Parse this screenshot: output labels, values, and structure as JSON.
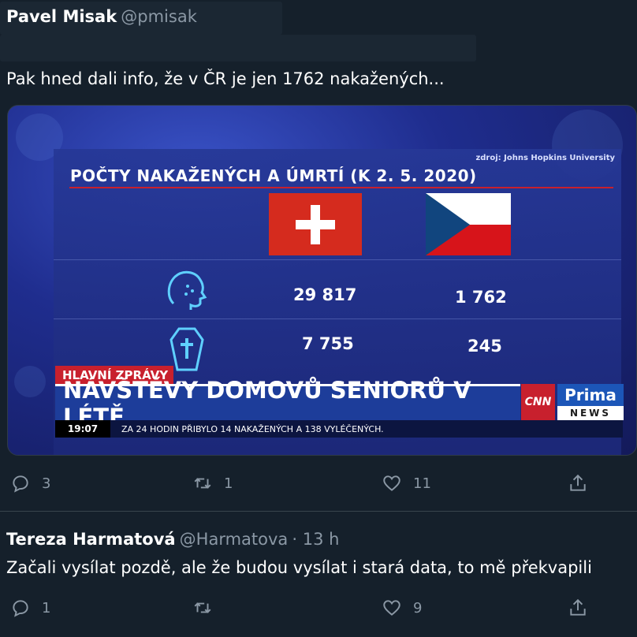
{
  "tweet1": {
    "name": "Pavel Misak",
    "handle": "@pmisak",
    "text": "Pak hned dali info, že v ČR je jen 1762 nakažených...",
    "replies": "3",
    "retweets": "1",
    "likes": "11"
  },
  "image": {
    "source": "zdroj: Johns Hopkins University",
    "title": "POČTY NAKAŽENÝCH A ÚMRTÍ (K 2. 5. 2020)",
    "ch_infected": "29 817",
    "cz_infected": "1 762",
    "ch_deaths": "7 755",
    "cz_deaths": "245",
    "banner_label": "HLAVNÍ ZPRÁVY",
    "headline": "NÁVŠTĚVY DOMOVŮ SENIORŮ V LÉTĚ",
    "time": "19:07",
    "ticker": "ZA 24 HODIN PŘIBYLO 14 NAKAŽENÝCH A 138 VYLÉČENÝCH.",
    "logo_cnn": "CNN",
    "logo_prima": "Prima",
    "logo_news": "NEWS"
  },
  "tweet2": {
    "name": "Tereza Harmatová",
    "handle": "@Harmatova",
    "time": "· 13 h",
    "text": "Začali vysílat pozdě, ale že budou vysílat i stará data, to mě překvapili",
    "replies": "1",
    "likes": "9"
  },
  "colors": {
    "background": "#15202b",
    "secondary_text": "#8b98a5",
    "tv_red": "#c8202d",
    "tv_blue": "#1d3d9a"
  }
}
